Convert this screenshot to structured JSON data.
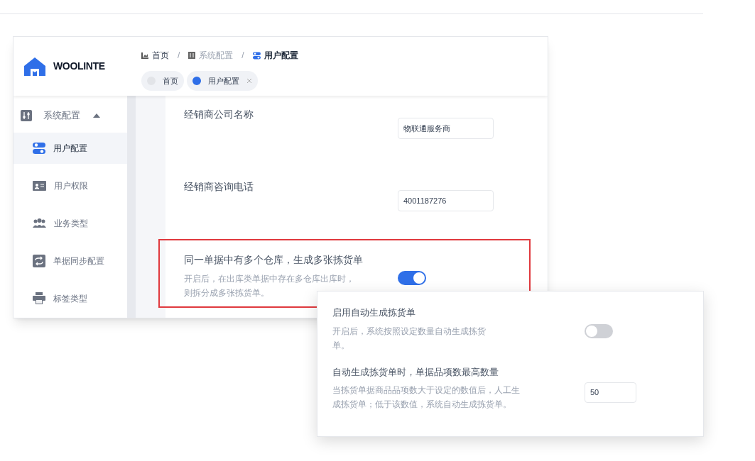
{
  "app": {
    "logo_text": "WOOLINTE"
  },
  "breadcrumb": [
    {
      "label": "首页"
    },
    {
      "separator": "/",
      "label": "系统配置"
    },
    {
      "separator": "/",
      "label": "用户配置"
    }
  ],
  "tabs": [
    {
      "label": "首页",
      "selected": false,
      "closable": false
    },
    {
      "label": "用户配置",
      "selected": true,
      "closable": true
    }
  ],
  "sidebar": {
    "group": {
      "label": "系统配置",
      "expanded": true
    },
    "items": [
      {
        "label": "用户配置",
        "selected": true
      },
      {
        "label": "用户权限",
        "selected": false
      },
      {
        "label": "业务类型",
        "selected": false
      },
      {
        "label": "单据同步配置",
        "selected": false
      },
      {
        "label": "标签类型",
        "selected": false
      }
    ]
  },
  "settings": [
    {
      "kind": "input",
      "label": "经销商公司名称",
      "value": "物联通服务商",
      "highlighted": false
    },
    {
      "kind": "input",
      "label": "经销商咨询电话",
      "value": "4001187276",
      "highlighted": false
    },
    {
      "kind": "switch",
      "label": "同一单据中有多个仓库，生成多张拣货单",
      "description": "开启后，在出库类单据中存在多仓库出库时，则拆分成多张拣货单。",
      "on": true,
      "highlighted": true
    }
  ],
  "popup_settings": [
    {
      "kind": "switch",
      "label": "启用自动生成拣货单",
      "description": "开启后，系统按照设定数量自动生成拣货单。",
      "on": false
    },
    {
      "kind": "input",
      "label": "自动生成拣货单时，单据品项数最高数量",
      "description": "当拣货单据商品品项数大于设定的数值后，人工生成拣货单；低于该数值，系统自动生成拣货单。",
      "value": "50"
    }
  ]
}
